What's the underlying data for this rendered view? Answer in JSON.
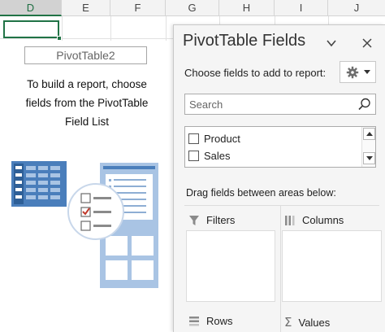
{
  "sheet": {
    "columns": [
      "D",
      "E",
      "F",
      "G",
      "H",
      "I",
      "J"
    ],
    "selected_column": "D"
  },
  "pivot": {
    "name": "PivotTable2",
    "instructions": "To build a report, choose fields from the PivotTable Field List"
  },
  "pane": {
    "title": "PivotTable Fields",
    "subtitle": "Choose fields to add to report:",
    "search_placeholder": "Search",
    "fields": [
      {
        "label": "Product",
        "checked": false
      },
      {
        "label": "Sales",
        "checked": false
      }
    ],
    "drag_label": "Drag fields between areas below:",
    "areas": {
      "filters": "Filters",
      "columns": "Columns",
      "rows": "Rows",
      "values": "Values"
    }
  },
  "colors": {
    "excel_green": "#217346",
    "illustration_blue": "#4a7ebb",
    "check_red": "#c0392b"
  }
}
